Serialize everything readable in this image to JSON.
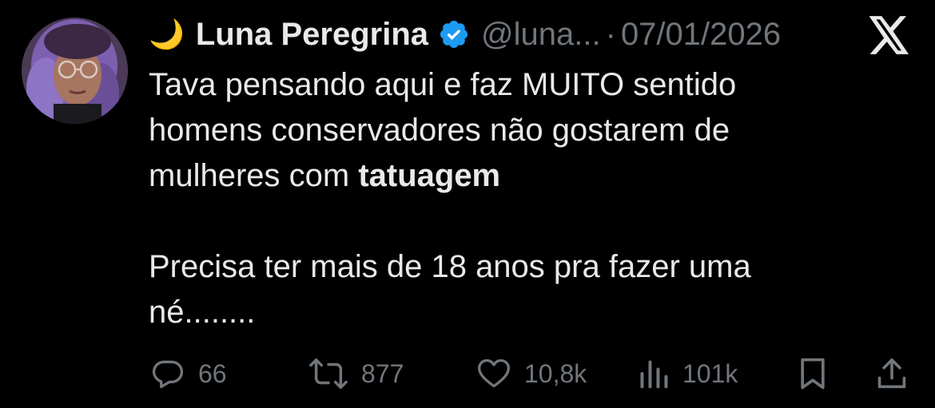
{
  "author": {
    "emoji": "🌙",
    "name": "Luna Peregrina",
    "handle": "@luna...",
    "separator": "·",
    "date": "07/01/2026"
  },
  "tweet": {
    "line1": "Tava pensando aqui e faz MUITO sentido",
    "line2": "homens conservadores não gostarem de",
    "line3_prefix": "mulheres com ",
    "line3_bold": "tatuagem",
    "line4": "Precisa ter mais de 18 anos pra fazer uma",
    "line5": "né........"
  },
  "metrics": {
    "replies": "66",
    "reposts": "877",
    "likes": "10,8k",
    "views": "101k"
  },
  "colors": {
    "background": "#000000",
    "text": "#e7e9ea",
    "muted": "#71767b",
    "verified": "#1d9bf0"
  },
  "icons": {
    "reply": "reply-icon",
    "repost": "repost-icon",
    "like": "heart-icon",
    "views": "views-icon",
    "bookmark": "bookmark-icon",
    "share": "share-icon",
    "verified": "verified-badge-icon",
    "brand": "x-logo-icon"
  }
}
